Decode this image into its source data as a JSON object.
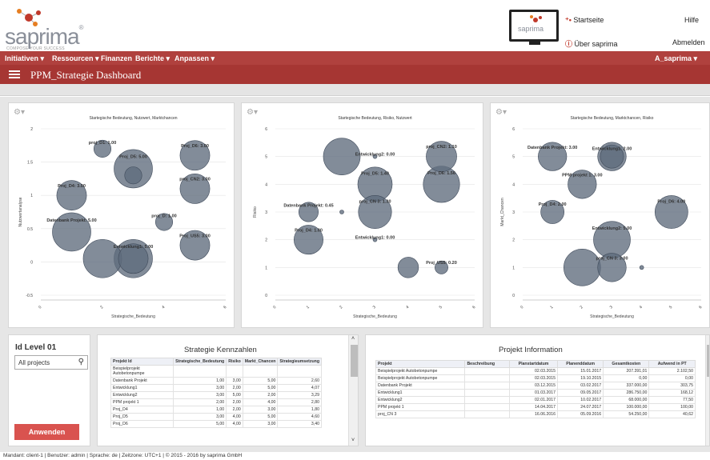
{
  "header": {
    "logo_text": "saprima",
    "logo_reg": "®",
    "logo_tagline": "COMPOSE YOUR SUCCESS",
    "monitor_text": "saprima",
    "startseite": "Startseite",
    "hilfe": "Hilfe",
    "ueber": "Über saprima",
    "abmelden": "Abmelden"
  },
  "menu": {
    "items": [
      "Initiativen ▾",
      "Ressourcen ▾",
      "Finanzen",
      "Berichte ▾",
      "Anpassen ▾"
    ],
    "user": "A_saprima ▾"
  },
  "title": "PPM_Strategie Dashboard",
  "charts": [
    {
      "title": "Startegische Bedeutung, Nutzwert, Marktchancen",
      "xlabel": "Strategische_Bedeutung",
      "ylabel": "Nutzwertanalyse"
    },
    {
      "title": "Startegische Bedeutung, Risiko, Nutzwert",
      "xlabel": "Strategische_Bedeutung",
      "ylabel": "Risiko"
    },
    {
      "title": "Startegische Bedeutung, Marktchancen, Risiko",
      "xlabel": "Strategische_Bedeutung",
      "ylabel": "Markt_Chancen"
    }
  ],
  "chart_data": [
    {
      "type": "scatter",
      "title": "Startegische Bedeutung, Nutzwert, Marktchancen",
      "xlabel": "Strategische_Bedeutung",
      "ylabel": "Nutzwertanalyse",
      "xlim": [
        0,
        6
      ],
      "ylim": [
        -0.5,
        2
      ],
      "xticks": [
        0,
        2,
        4,
        6
      ],
      "yticks": [
        -0.5,
        0,
        0.5,
        1,
        1.5,
        2
      ],
      "points": [
        {
          "label": "proj_D1: 1.00",
          "x": 2,
          "y": 1.7,
          "r": 1
        },
        {
          "label": "Proj_D5: 5.00",
          "x": 3,
          "y": 1.4,
          "r": 5
        },
        {
          "label": "Proj_D6: 3.00",
          "x": 5,
          "y": 1.6,
          "r": 3
        },
        {
          "label": "proj_CN2: 3.00",
          "x": 5,
          "y": 1.1,
          "r": 3
        },
        {
          "label": "Proj_D4: 3.00",
          "x": 1,
          "y": 1.0,
          "r": 3
        },
        {
          "label": "proj_D: 1.00",
          "x": 4,
          "y": 0.6,
          "r": 1
        },
        {
          "label": "Datenbank Projekt: 5.00",
          "x": 1,
          "y": 0.45,
          "r": 5
        },
        {
          "label": "Proj_US5: 3.00",
          "x": 5,
          "y": 0.25,
          "r": 3
        },
        {
          "label": "Entwicklung1: 5.00",
          "x": 3,
          "y": 0.05,
          "r": 5
        },
        {
          "label": "",
          "x": 2,
          "y": 0.05,
          "r": 5
        },
        {
          "label": "",
          "x": 3,
          "y": 1.3,
          "r": 1
        },
        {
          "label": "",
          "x": 3,
          "y": 0.05,
          "r": 3
        }
      ]
    },
    {
      "type": "scatter",
      "title": "Startegische Bedeutung, Risiko, Nutzwert",
      "xlabel": "Strategische_Bedeutung",
      "ylabel": "Risiko",
      "xlim": [
        0,
        6
      ],
      "ylim": [
        0,
        6
      ],
      "xticks": [
        0,
        1,
        2,
        3,
        4,
        5,
        6
      ],
      "yticks": [
        0,
        1,
        2,
        3,
        4,
        5,
        6
      ],
      "points": [
        {
          "label": "Entwicklung2: 0.00",
          "x": 3,
          "y": 5,
          "r": 0
        },
        {
          "label": "proj_CN2: 1.10",
          "x": 5,
          "y": 5,
          "r": 1.1
        },
        {
          "label": "Proj_D5: 1.40",
          "x": 3,
          "y": 4,
          "r": 1.4
        },
        {
          "label": "Proj_D6: 1.56",
          "x": 5,
          "y": 4,
          "r": 1.56
        },
        {
          "label": "Datenbank Projekt: 0.45",
          "x": 1,
          "y": 3,
          "r": 0.45
        },
        {
          "label": "proj_CN 3: 1.30",
          "x": 3,
          "y": 3,
          "r": 1.3
        },
        {
          "label": "Proj_D4: 1.00",
          "x": 1,
          "y": 2,
          "r": 1
        },
        {
          "label": "Entwicklung1: 0.00",
          "x": 3,
          "y": 2,
          "r": 0
        },
        {
          "label": "Proj_US5: 0.20",
          "x": 5,
          "y": 1,
          "r": 0.2
        },
        {
          "label": "",
          "x": 2,
          "y": 5,
          "r": 1.6
        },
        {
          "label": "",
          "x": 4,
          "y": 1,
          "r": 0.5
        },
        {
          "label": "",
          "x": 2,
          "y": 3,
          "r": 0
        }
      ]
    },
    {
      "type": "scatter",
      "title": "Startegische Bedeutung, Marktchancen, Risiko",
      "xlabel": "Strategische_Bedeutung",
      "ylabel": "Markt_Chancen",
      "xlim": [
        0,
        6
      ],
      "ylim": [
        0,
        6
      ],
      "xticks": [
        0,
        1,
        2,
        3,
        4,
        5,
        6
      ],
      "yticks": [
        0,
        1,
        2,
        3,
        4,
        5,
        6
      ],
      "points": [
        {
          "label": "Datenbank Projekt: 3.00",
          "x": 1,
          "y": 5,
          "r": 3
        },
        {
          "label": "Entwicklung1: 2.00",
          "x": 3,
          "y": 5,
          "r": 2
        },
        {
          "label": "PPM projekt 1: 3.00",
          "x": 2,
          "y": 4,
          "r": 3
        },
        {
          "label": "Proj_D4: 2.00",
          "x": 1,
          "y": 3,
          "r": 2
        },
        {
          "label": "Proj_D6: 4.00",
          "x": 5,
          "y": 3,
          "r": 4
        },
        {
          "label": "Entwicklung2: 5.00",
          "x": 3,
          "y": 2,
          "r": 5
        },
        {
          "label": "proj_CN 3: 3.00",
          "x": 3,
          "y": 1,
          "r": 3
        },
        {
          "label": "",
          "x": 2,
          "y": 1,
          "r": 5
        },
        {
          "label": "",
          "x": 4,
          "y": 1,
          "r": 0
        },
        {
          "label": "",
          "x": 3,
          "y": 5,
          "r": 3
        }
      ]
    }
  ],
  "filter": {
    "title": "Id Level 01",
    "select_value": "All projects",
    "apply_button": "Anwenden"
  },
  "kennzahlen": {
    "title": "Strategie  Kennzahlen",
    "headers": [
      "Projekt Id",
      "Strategische_Bedeutung",
      "Risiko",
      "Markt_Chancen",
      "Strategieumsetzung"
    ],
    "rows": [
      [
        "Beispielprojekt Autobetonpumpe",
        "",
        "",
        "",
        ""
      ],
      [
        "Datenbank Projekt",
        "1,00",
        "3,00",
        "5,00",
        "2,60"
      ],
      [
        "Entwicklung1",
        "3,00",
        "2,00",
        "5,00",
        "4,07"
      ],
      [
        "Entwicklung2",
        "3,00",
        "5,00",
        "2,00",
        "3,29"
      ],
      [
        "PPM projekt 1",
        "2,00",
        "2,00",
        "4,00",
        "2,80"
      ],
      [
        "Proj_D4",
        "1,00",
        "2,00",
        "3,00",
        "1,80"
      ],
      [
        "Proj_D5",
        "3,00",
        "4,00",
        "5,00",
        "4,60"
      ],
      [
        "Proj_D6",
        "5,00",
        "4,00",
        "3,00",
        "3,40"
      ]
    ]
  },
  "projektinfo": {
    "title": "Projekt Information",
    "headers": [
      "Projekt",
      "Beschreibung",
      "Planstartdatum",
      "Planenddatum",
      "Gesamtkosten",
      "Aufwend in PT"
    ],
    "rows": [
      [
        "Beispielprojekt Autobetonpumpe",
        "",
        "02.03.2015",
        "15.01.2017",
        "207.391,01",
        "2.102,50"
      ],
      [
        "Beispielprojekt Autobetonpumpe",
        "",
        "02.03.2015",
        "19.10.2015",
        "0,00",
        "0,00"
      ],
      [
        "Datenbank Projekt",
        "",
        "03.12.2015",
        "03.02.2017",
        "337.000,00",
        "303,75"
      ],
      [
        "Entwicklung1",
        "",
        "01.03.2017",
        "09.05.2017",
        "286.750,00",
        "168,12"
      ],
      [
        "Entwicklung2",
        "",
        "02.01.2017",
        "10.02.2017",
        "68.000,00",
        "77,50"
      ],
      [
        "PPM projekt 1",
        "",
        "14.04.2017",
        "24.07.2017",
        "100.000,00",
        "100,00"
      ],
      [
        "proj_CN 3",
        "",
        "16.06.2016",
        "05.09.2016",
        "54.250,00",
        "40,62"
      ]
    ]
  },
  "footer": "Mandant: client-1 | Benutzer: admin | Sprache: de | Zeitzone: UTC+1 | © 2015 - 2016 by saprima GmbH",
  "colors": {
    "brand_red": "#b0413e",
    "bubble": "#5f6b7c",
    "button": "#d9534f"
  }
}
